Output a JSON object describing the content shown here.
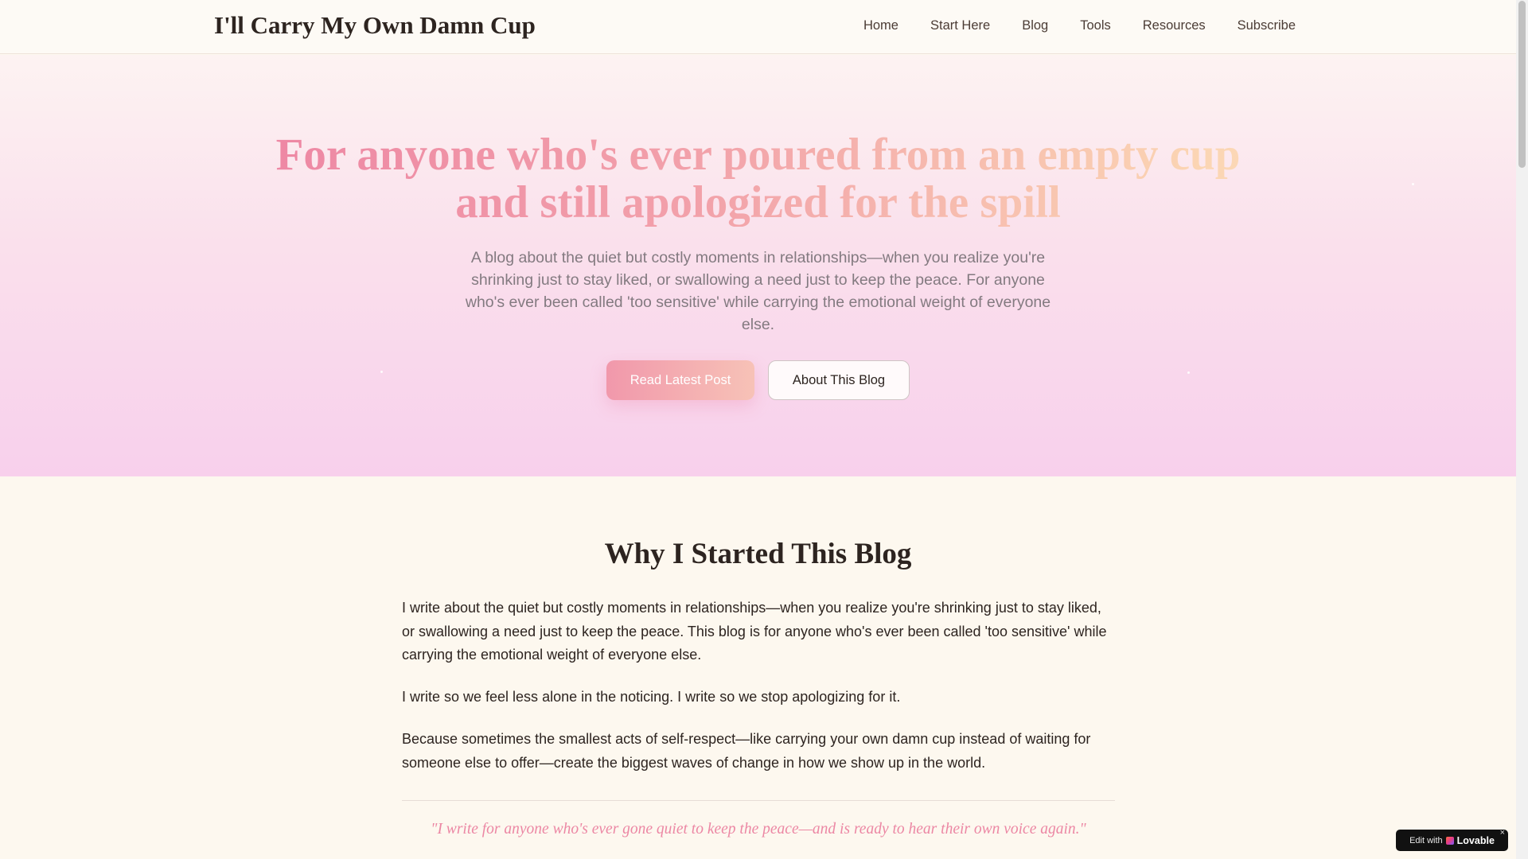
{
  "site": {
    "brand": "I'll Carry My Own Damn Cup"
  },
  "nav": {
    "items": [
      "Home",
      "Start Here",
      "Blog",
      "Tools",
      "Resources",
      "Subscribe"
    ]
  },
  "hero": {
    "title_line1": "For anyone who's ever poured from an empty cup",
    "title_line2": "and still apologized for the spill",
    "subtitle": "A blog about the quiet but costly moments in relationships—when you realize you're shrinking just to stay liked, or swallowing a need just to keep the peace. For anyone who's ever been called 'too sensitive' while carrying the emotional weight of everyone else.",
    "primary_button": "Read Latest Post",
    "secondary_button": "About This Blog"
  },
  "about": {
    "title": "Why I Started This Blog",
    "paragraphs": [
      "I write about the quiet but costly moments in relationships—when you realize you're shrinking just to stay liked, or swallowing a need just to keep the peace. This blog is for anyone who's ever been called 'too sensitive' while carrying the emotional weight of everyone else.",
      "I write so we feel less alone in the noticing. I write so we stop apologizing for it.",
      "Because sometimes the smallest acts of self-respect—like carrying your own damn cup instead of waiting for someone else to offer—create the biggest waves of change in how we show up in the world."
    ],
    "quote": "\"I write for anyone who's ever gone quiet to keep the peace—and is ready to hear their own voice again.\""
  },
  "badge": {
    "prefix": "Edit with",
    "brand": "Lovable",
    "close": "×"
  },
  "colors": {
    "accent_pink": "#ec7fa2",
    "accent_peach": "#fbd5b3",
    "background": "#fdf8ef"
  }
}
